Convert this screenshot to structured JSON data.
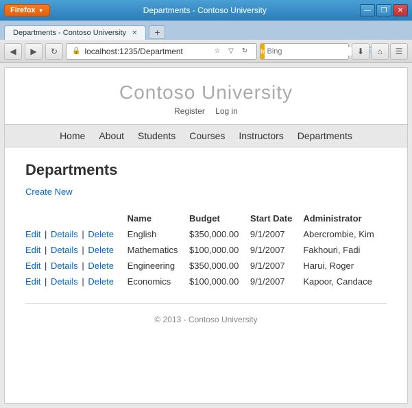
{
  "window": {
    "title": "Departments - Contoso University",
    "firefox_btn": "Firefox",
    "controls": {
      "minimize": "—",
      "restore": "❐",
      "close": "✕"
    }
  },
  "tab": {
    "label": "Departments - Contoso University",
    "close": "✕",
    "new_tab": "+"
  },
  "navbar": {
    "back": "◀",
    "forward": "▶",
    "refresh": "↻",
    "address": "localhost:1235/Department",
    "address_icon": "🔒",
    "search_placeholder": "Bing",
    "search_logo": "Bing",
    "download": "⬇",
    "home": "⌂",
    "menu": "☰"
  },
  "page": {
    "university_name": "Contoso University",
    "auth_links": {
      "register": "Register",
      "login": "Log in"
    },
    "nav_items": [
      "Home",
      "About",
      "Students",
      "Courses",
      "Instructors",
      "Departments"
    ],
    "heading": "Departments",
    "create_new": "Create New",
    "table": {
      "headers": [
        "",
        "Name",
        "Budget",
        "Start Date",
        "Administrator"
      ],
      "rows": [
        {
          "actions": [
            "Edit",
            "Details",
            "Delete"
          ],
          "name": "English",
          "budget": "$350,000.00",
          "start_date": "9/1/2007",
          "administrator": "Abercrombie, Kim"
        },
        {
          "actions": [
            "Edit",
            "Details",
            "Delete"
          ],
          "name": "Mathematics",
          "budget": "$100,000.00",
          "start_date": "9/1/2007",
          "administrator": "Fakhouri, Fadi"
        },
        {
          "actions": [
            "Edit",
            "Details",
            "Delete"
          ],
          "name": "Engineering",
          "budget": "$350,000.00",
          "start_date": "9/1/2007",
          "administrator": "Harui, Roger"
        },
        {
          "actions": [
            "Edit",
            "Details",
            "Delete"
          ],
          "name": "Economics",
          "budget": "$100,000.00",
          "start_date": "9/1/2007",
          "administrator": "Kapoor, Candace"
        }
      ]
    },
    "footer": "© 2013 - Contoso University"
  }
}
